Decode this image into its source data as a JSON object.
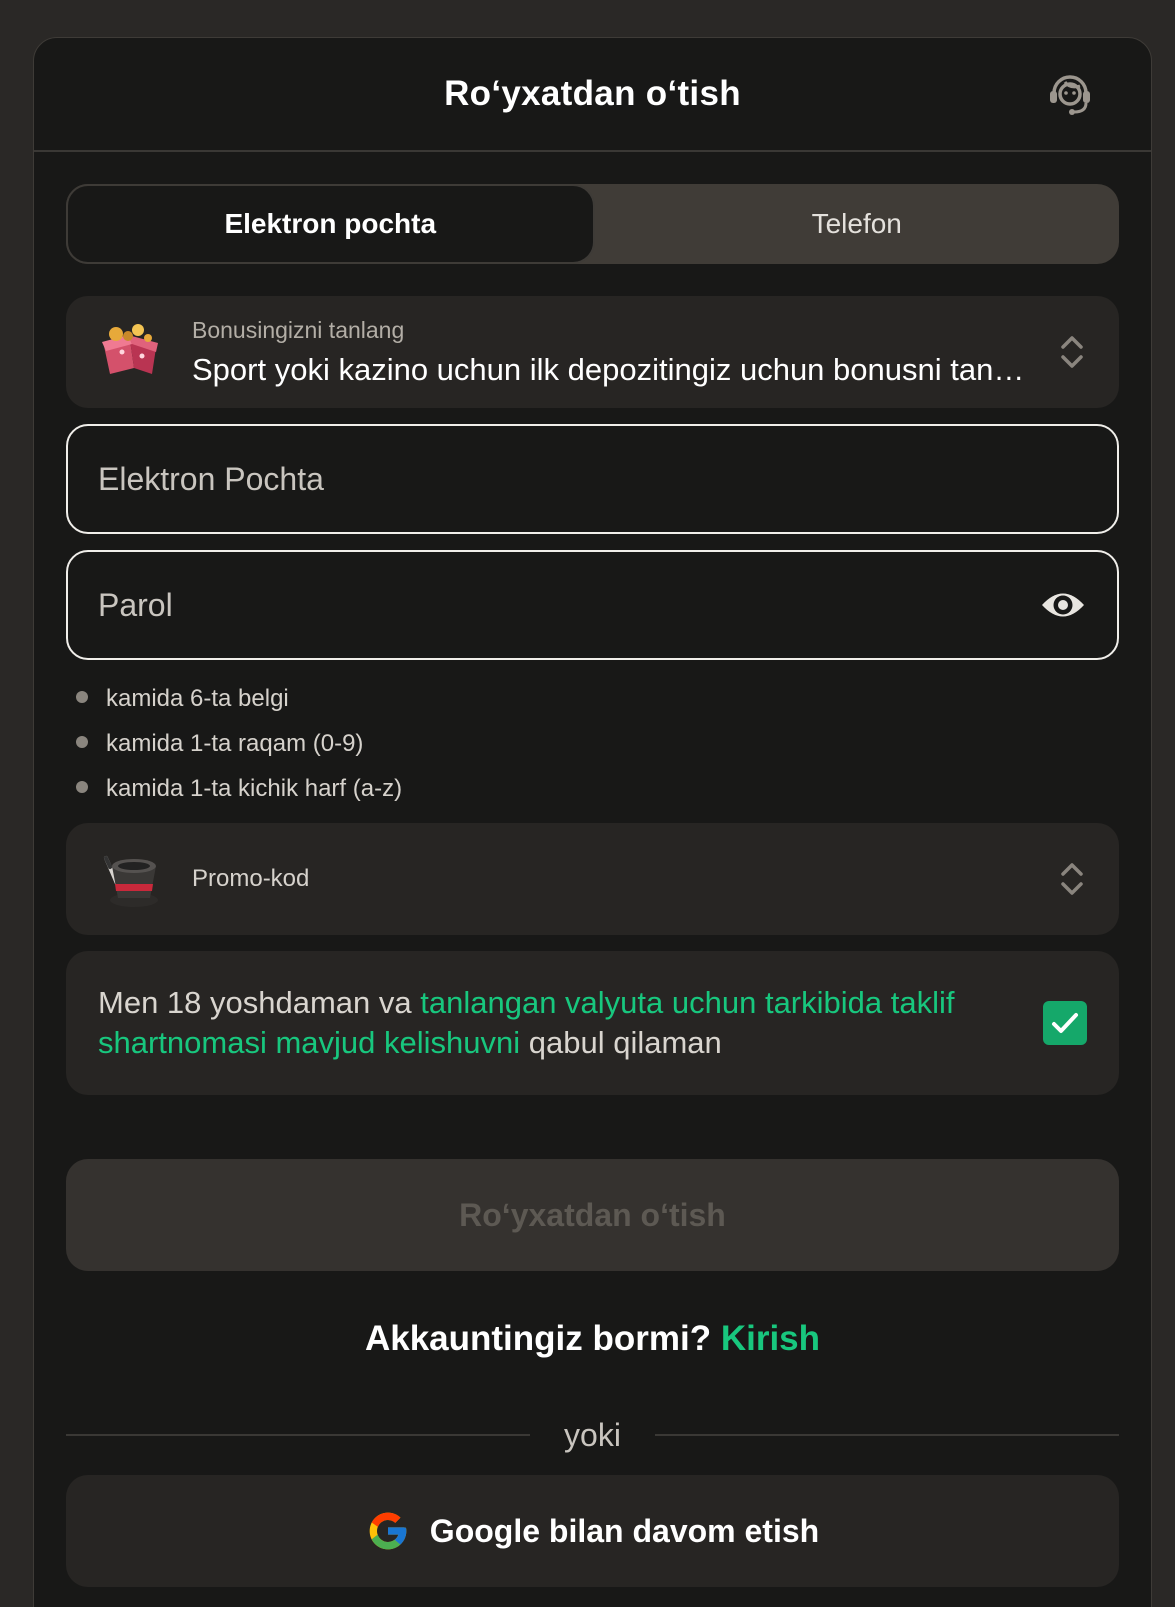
{
  "header": {
    "title": "Roʻyxatdan oʻtish",
    "support_icon": "headset-icon"
  },
  "tabs": [
    {
      "label": "Elektron pochta",
      "active": true
    },
    {
      "label": "Telefon",
      "active": false
    }
  ],
  "bonus": {
    "icon": "gift-box-icon",
    "label": "Bonusingizni tanlang",
    "value": "Sport yoki kazino uchun ilk depozitingiz uchun bonusni tanlang"
  },
  "email": {
    "placeholder": "Elektron Pochta",
    "value": ""
  },
  "password": {
    "placeholder": "Parol",
    "value": "",
    "toggle_icon": "eye-icon"
  },
  "password_rules": [
    "kamida 6-ta belgi",
    "kamida 1-ta raqam (0-9)",
    "kamida 1-ta kichik harf (a-z)"
  ],
  "promo": {
    "icon": "magic-hat-icon",
    "label": "Promo-kod"
  },
  "agreement": {
    "text_before": "Men 18 yoshdaman va ",
    "link_text": "tanlangan valyuta uchun tarkibida taklif shartnomasi mavjud kelishuvni",
    "text_after": " qabul qilaman",
    "checked": true
  },
  "submit_label": "Roʻyxatdan oʻtish",
  "login": {
    "question": "Akkauntingiz bormi? ",
    "link": "Kirish"
  },
  "divider_text": "yoki",
  "google_label": "Google bilan davom etish",
  "colors": {
    "accent": "#18c77e",
    "checkbox": "#15a86a",
    "background": "#181817",
    "page": "#2a2826"
  }
}
